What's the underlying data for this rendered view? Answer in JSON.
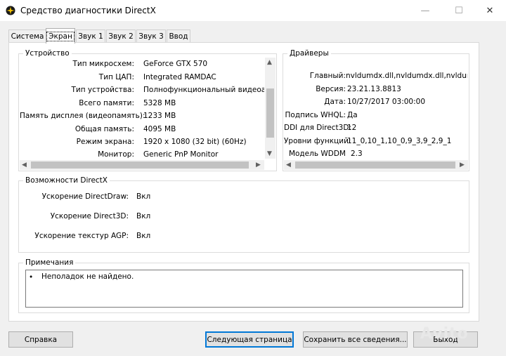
{
  "window": {
    "title": "Средство диагностики DirectX",
    "controls": {
      "minimize": "—",
      "maximize": "☐",
      "close": "✕"
    }
  },
  "tabs": [
    {
      "label": "Система",
      "active": false
    },
    {
      "label": "Экран",
      "active": true
    },
    {
      "label": "Звук 1",
      "active": false
    },
    {
      "label": "Звук 2",
      "active": false
    },
    {
      "label": "Звук 3",
      "active": false
    },
    {
      "label": "Ввод",
      "active": false
    }
  ],
  "device": {
    "title": "Устройство",
    "rows": [
      {
        "key": "Тип микросхем:",
        "value": "GeForce GTX 570"
      },
      {
        "key": "Тип ЦАП:",
        "value": "Integrated RAMDAC"
      },
      {
        "key": "Тип устройства:",
        "value": "Полнофункциональный видеоадап"
      },
      {
        "key": "Всего памяти:",
        "value": "5328 MB"
      },
      {
        "key": "Память дисплея (видеопамять):",
        "value": "1233 MB"
      },
      {
        "key": "Общая память:",
        "value": "4095 MB"
      },
      {
        "key": "Режим экрана:",
        "value": "1920 x 1080 (32 bit) (60Hz)"
      },
      {
        "key": "Монитор:",
        "value": "Generic PnP Monitor"
      }
    ]
  },
  "drivers": {
    "title": "Драйверы",
    "rows": [
      {
        "key": "Главный:",
        "value": "nvldumdx.dll,nvldumdx.dll,nvldumdx.c"
      },
      {
        "key": "Версия:",
        "value": "23.21.13.8813"
      },
      {
        "key": "Дата:",
        "value": "10/27/2017 03:00:00"
      },
      {
        "key": "Подпись WHQL:",
        "value": "Да"
      },
      {
        "key": "DDI для Direct3D:",
        "value": "12"
      },
      {
        "key": "Уровни функций:",
        "value": "11_0,10_1,10_0,9_3,9_2,9_1"
      },
      {
        "key": "Модель WDDM",
        "value": "2.3"
      }
    ]
  },
  "features": {
    "title": "Возможности DirectX",
    "rows": [
      {
        "key": "Ускорение DirectDraw:",
        "value": "Вкл"
      },
      {
        "key": "Ускорение Direct3D:",
        "value": "Вкл"
      },
      {
        "key": "Ускорение текстур AGP:",
        "value": "Вкл"
      }
    ]
  },
  "notes": {
    "title": "Примечания",
    "items": [
      "Неполадок не найдено."
    ]
  },
  "buttons": {
    "help": "Справка",
    "next": "Следующая страница",
    "save": "Сохранить все сведения...",
    "exit": "Выход"
  },
  "watermark": "Avito"
}
